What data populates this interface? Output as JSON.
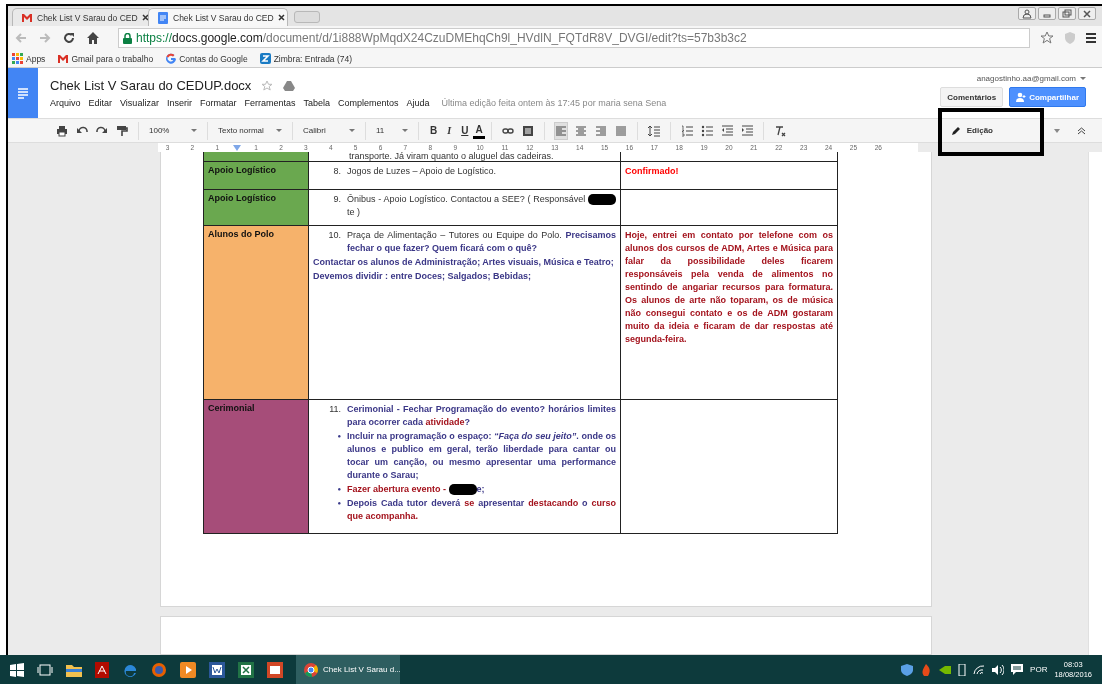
{
  "browser": {
    "tabs": [
      {
        "title": "Chek List V Sarau do CED",
        "kind": "mail",
        "selected": false
      },
      {
        "title": "Chek List V Sarau do CED",
        "kind": "doc",
        "selected": true
      }
    ],
    "url": {
      "scheme": "https://",
      "host": "docs.google.com",
      "path": "/document/d/1i888WpMqdX24CzuDMEhqCh9l_HVdlN_FQTdR8V_DVGI/edit?ts=57b3b3c2"
    },
    "bookmarks": [
      {
        "label": "Apps",
        "kind": "apps"
      },
      {
        "label": "Gmail para o trabalho",
        "kind": "mail"
      },
      {
        "label": "Contas do Google",
        "kind": "google"
      },
      {
        "label": "Zimbra: Entrada (74)",
        "kind": "zimbra"
      }
    ]
  },
  "docs": {
    "title": "Chek List V Sarau do CEDUP.docx",
    "account": "anagostinho.aa@gmail.com",
    "menu": [
      "Arquivo",
      "Editar",
      "Visualizar",
      "Inserir",
      "Formatar",
      "Ferramentas",
      "Tabela",
      "Complementos",
      "Ajuda"
    ],
    "last_edit": "Última edição feita ontem às 17:45 por maria sena Sena",
    "comments_button": "Comentários",
    "share_button": "Compartilhar",
    "toolbar": {
      "zoom": "100%",
      "style": "Texto normal",
      "font": "Calibri",
      "size": "11",
      "format_letters": [
        "B",
        "I",
        "U",
        "A"
      ],
      "mode": "Edição"
    },
    "ruler": [
      "3",
      "2",
      "1",
      "1",
      "2",
      "3",
      "4",
      "5",
      "6",
      "7",
      "8",
      "9",
      "10",
      "11",
      "12",
      "13",
      "14",
      "15",
      "16",
      "17",
      "18",
      "19",
      "20",
      "21",
      "22",
      "23",
      "24",
      "25",
      "26"
    ]
  },
  "table": {
    "partial_text": "transporte. Já viram quanto o aluguel das cadeiras.",
    "rows": [
      {
        "category": "Apoio Logístico",
        "color": "#6aa84f",
        "task": [
          {
            "kind": "numbered",
            "marker": "8.",
            "segments": [
              {
                "kind": "normal",
                "text": "Jogos de Luzes – Apoio de Logístico."
              }
            ]
          }
        ],
        "notes": [
          {
            "segments": [
              {
                "kind": "confirm",
                "text": "Confirmado!"
              }
            ]
          }
        ]
      },
      {
        "category": "Apoio Logístico",
        "color": "#6aa84f",
        "task": [
          {
            "kind": "numbered",
            "marker": "9.",
            "segments": [
              {
                "kind": "normal",
                "text": "Ônibus - Apoio Logístico. Contactou a SEE? ( Responsável "
              },
              {
                "kind": "redacted"
              },
              {
                "kind": "normal",
                "text": "te )"
              }
            ]
          }
        ],
        "notes": []
      },
      {
        "category": "Alunos do Polo",
        "color": "#f6b26b",
        "task": [
          {
            "kind": "numbered",
            "marker": "10.",
            "segments": [
              {
                "kind": "normal",
                "text": "Praça de Alimentação – Tutores ou Equipe do Polo. "
              },
              {
                "kind": "emphasis",
                "text": "Precisamos fechar o que fazer? Quem ficará com o quê?"
              }
            ]
          },
          {
            "kind": "plain",
            "segments": [
              {
                "kind": "emphasis",
                "text": "Contactar os alunos de Administração; Artes visuais, Música e Teatro;"
              }
            ]
          },
          {
            "kind": "plain",
            "segments": [
              {
                "kind": "emphasis",
                "text": "Devemos dividir : entre Doces; Salgados; Bebidas;"
              }
            ]
          }
        ],
        "notes": [
          {
            "segments": [
              {
                "kind": "alert",
                "text": "Hoje, entrei em contato por telefone  com os alunos dos cursos de ADM, Artes e Música para  falar da possibilidade deles ficarem responsáveis pela venda de alimentos no sentindo de angariar recursos para formatura. Os alunos de arte não toparam, os de música não consegui contato e os de ADM gostaram muito da ideia e ficaram de dar respostas até segunda-feira."
              }
            ]
          }
        ]
      },
      {
        "category": "Cerimonial",
        "color": "#a64d79",
        "task": [
          {
            "kind": "numbered",
            "marker": "11.",
            "segments": [
              {
                "kind": "emphasis",
                "text": "Cerimonial - Fechar Programação do evento? horários limites para ocorrer cada "
              },
              {
                "kind": "alert",
                "text": "atividade"
              },
              {
                "kind": "emphasis",
                "text": "?"
              }
            ]
          },
          {
            "kind": "bullet",
            "marker": "●",
            "segments": [
              {
                "kind": "emphasis",
                "text": "Incluir na programação o espaço: *“Faça do seu jeito”*. onde os alunos e publico em geral,  terão liberdade para cantar ou tocar um canção, ou mesmo apresentar uma performance durante o Sarau;"
              }
            ]
          },
          {
            "kind": "bullet",
            "marker": "●",
            "segments": [
              {
                "kind": "alert",
                "text": " Fazer abertura evento  - "
              },
              {
                "kind": "redacted"
              },
              {
                "kind": "emphasis",
                "text": "e;"
              }
            ]
          },
          {
            "kind": "bullet",
            "marker": "●",
            "segments": [
              {
                "kind": "emphasis",
                "text": "Depois Cada tutor deverá "
              },
              {
                "kind": "alert",
                "text": "se"
              },
              {
                "kind": "emphasis",
                "text": "  apresentar "
              },
              {
                "kind": "alert",
                "text": "destacando"
              },
              {
                "kind": "emphasis",
                "text": " o "
              },
              {
                "kind": "alert",
                "text": "curso que acompanha."
              }
            ]
          }
        ],
        "notes": []
      }
    ]
  },
  "taskbar": {
    "window_title": "Chek List V Sarau d...",
    "language": "POR",
    "time": "08:03",
    "date": "18/08/2016"
  }
}
